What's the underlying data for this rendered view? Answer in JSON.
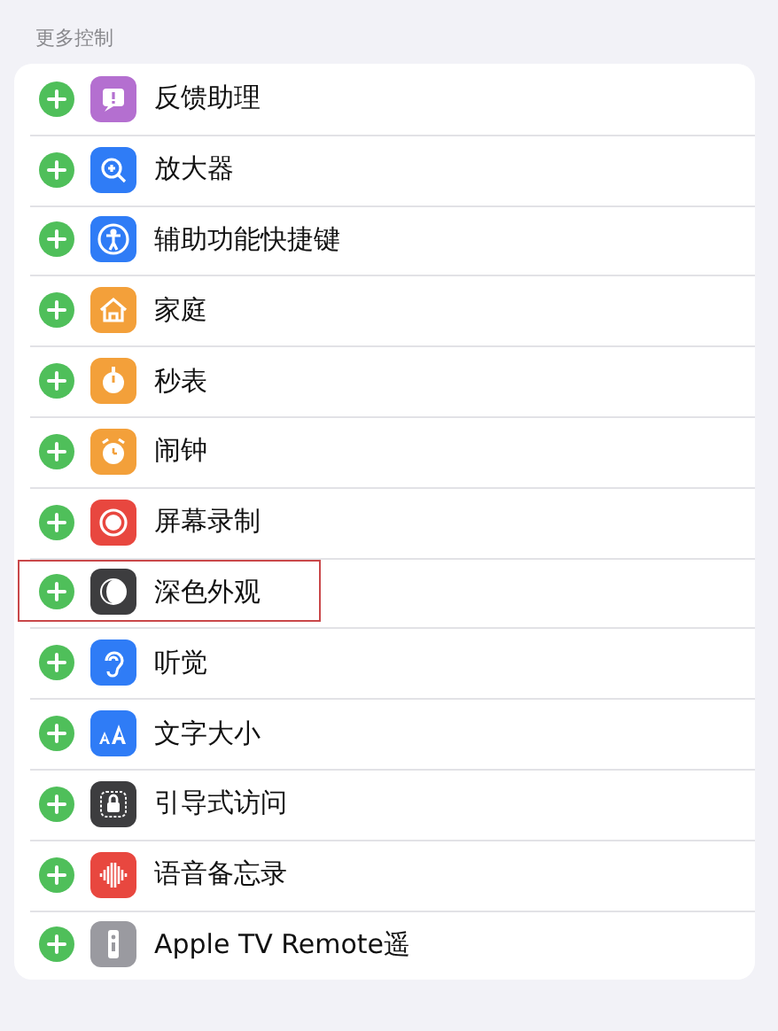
{
  "section_header": "更多控制",
  "controls": [
    {
      "label": "反馈助理",
      "kind": "feedback",
      "color": "#b46fd0",
      "highlighted": false
    },
    {
      "label": "放大器",
      "kind": "magnifier",
      "color": "#2f7cf6",
      "highlighted": false
    },
    {
      "label": "辅助功能快捷键",
      "kind": "accessibility",
      "color": "#2f7cf6",
      "highlighted": false
    },
    {
      "label": "家庭",
      "kind": "home",
      "color": "#f3a03a",
      "highlighted": false
    },
    {
      "label": "秒表",
      "kind": "stopwatch",
      "color": "#f3a03a",
      "highlighted": false
    },
    {
      "label": "闹钟",
      "kind": "alarm",
      "color": "#f3a03a",
      "highlighted": false
    },
    {
      "label": "屏幕录制",
      "kind": "record",
      "color": "#e8473f",
      "highlighted": false
    },
    {
      "label": "深色外观",
      "kind": "dark",
      "color": "#3d3d3f",
      "highlighted": true
    },
    {
      "label": "听觉",
      "kind": "ear",
      "color": "#2f7cf6",
      "highlighted": false
    },
    {
      "label": "文字大小",
      "kind": "textsize",
      "color": "#2f7cf6",
      "highlighted": false
    },
    {
      "label": "引导式访问",
      "kind": "lock",
      "color": "#3d3d3f",
      "highlighted": false
    },
    {
      "label": "语音备忘录",
      "kind": "wave",
      "color": "#e8473f",
      "highlighted": false
    },
    {
      "label": "Apple TV Remote遥",
      "kind": "remote",
      "color": "#9a9aa0",
      "highlighted": false
    }
  ]
}
